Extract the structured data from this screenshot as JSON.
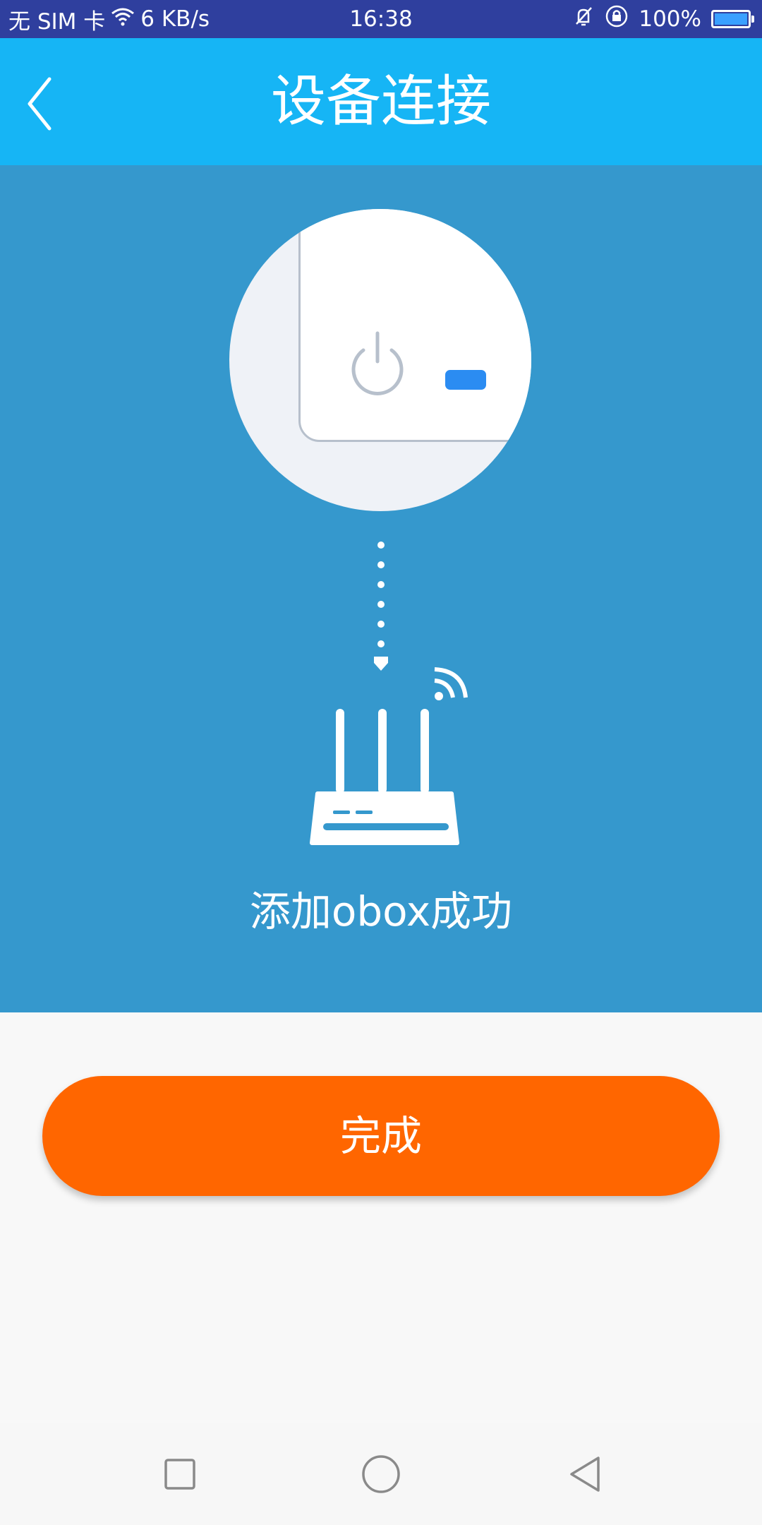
{
  "status_bar": {
    "sim": "无 SIM 卡",
    "speed": "6 KB/s",
    "time": "16:38",
    "battery": "100%",
    "icons": [
      "wifi-icon",
      "mute-vibrate-icon",
      "rotation-lock-icon",
      "battery-icon"
    ],
    "battery_level": 1.0
  },
  "header": {
    "title": "设备连接",
    "back_icon": "chevron-left-icon"
  },
  "hero": {
    "device_icon": "smart-switch-power-icon",
    "arrow_icon": "dotted-down-arrow-icon",
    "router_icon": "router-icon",
    "signal_icon": "wifi-signal-icon",
    "message": "添加obox成功"
  },
  "actions": {
    "done_label": "完成"
  },
  "nav": {
    "recents_icon": "square-icon",
    "home_icon": "circle-icon",
    "back_icon": "triangle-back-icon"
  },
  "colors": {
    "status_bar": "#2f3f9e",
    "app_bar": "#16b5f5",
    "hero_bg": "#3598cd",
    "accent_button": "#ff6600",
    "indicator_led": "#2b8cf2"
  }
}
